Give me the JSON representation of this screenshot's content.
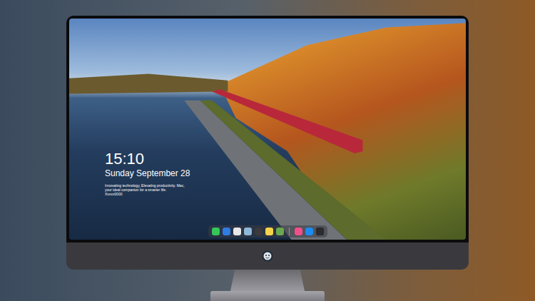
{
  "lock_screen": {
    "time": "15:10",
    "date": "Sunday September 28",
    "tagline": "Innovating technology, Elevating productivity. Mac, your ideal companion for a smarter life. Xxxxx0000"
  },
  "dock": {
    "groups": [
      [
        {
          "color": "#34c759"
        },
        {
          "color": "#2f7de1"
        },
        {
          "color": "#e8e8ea"
        },
        {
          "color": "#8fb8d8"
        },
        {
          "color": "#3a3a3c"
        },
        {
          "color": "#f5d34a"
        },
        {
          "color": "#6aa84f"
        }
      ],
      [
        {
          "color": "#f0508a"
        },
        {
          "color": "#1c8cf0"
        },
        {
          "color": "#2c2c2e"
        }
      ]
    ]
  }
}
